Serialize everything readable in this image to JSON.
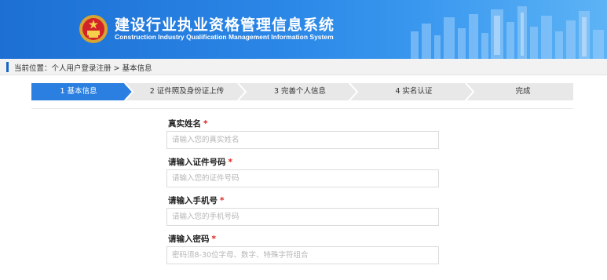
{
  "header": {
    "title_cn": "建设行业执业资格管理信息系统",
    "title_en": "Construction Industry Qualification Management Information System",
    "emblem_icon": "national-emblem-icon"
  },
  "breadcrumb": {
    "text": "当前位置：个人用户登录注册 > 基本信息"
  },
  "steps": [
    {
      "label": "1 基本信息",
      "active": true
    },
    {
      "label": "2 证件照及身份证上传",
      "active": false
    },
    {
      "label": "3 完善个人信息",
      "active": false
    },
    {
      "label": "4 实名认证",
      "active": false
    },
    {
      "label": "完成",
      "active": false
    }
  ],
  "form": {
    "fields": [
      {
        "label": "真实姓名",
        "required": "*",
        "placeholder": "请输入您的真实姓名",
        "value": ""
      },
      {
        "label": "请输入证件号码",
        "required": "*",
        "placeholder": "请输入您的证件号码",
        "value": ""
      },
      {
        "label": "请输入手机号",
        "required": "*",
        "placeholder": "请输入您的手机号码",
        "value": ""
      },
      {
        "label": "请输入密码",
        "required": "*",
        "placeholder": "密码须8-30位字母、数字、特殊字符组合",
        "value": ""
      }
    ]
  },
  "colors": {
    "active_step": "#2b7fe0",
    "inactive_step": "#e8e8e8",
    "required": "#e0211d",
    "banner": "#1d6fd3"
  }
}
